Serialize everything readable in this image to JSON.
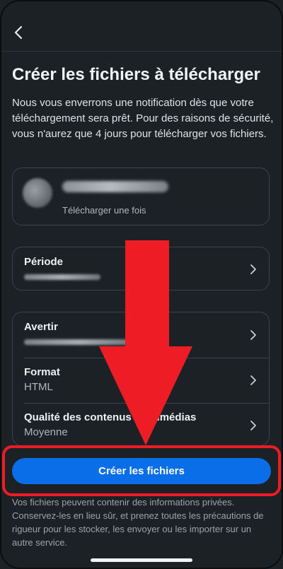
{
  "header": {
    "back_icon": "chevron-left-icon"
  },
  "title": "Créer les fichiers à télécharger",
  "description": "Nous vous enverrons une notification dès que votre téléchargement sera prêt. Pour des raisons de sécurité, vous n'aurez que 4 jours pour télécharger vos fichiers.",
  "profile": {
    "subtitle": "Télécharger une fois"
  },
  "period": {
    "label": "Période"
  },
  "settings": {
    "notify_label": "Avertir",
    "format_label": "Format",
    "format_value": "HTML",
    "quality_label": "Qualité des contenus multimédias",
    "quality_value": "Moyenne"
  },
  "create_button_label": "Créer les fichiers",
  "footer_note": "Vos fichiers peuvent contenir des informations privées. Conservez-les en lieu sûr, et prenez toutes les précautions de rigueur pour les stocker, les envoyer ou les importer sur un autre service.",
  "colors": {
    "background": "#1c2126",
    "button": "#0a6ee8",
    "annotation_red": "#ee1c24"
  }
}
